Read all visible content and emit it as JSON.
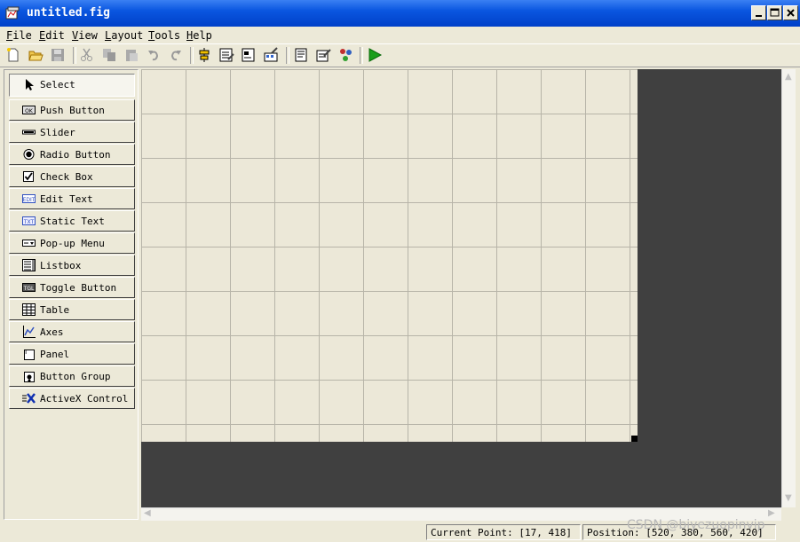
{
  "window": {
    "title": "untitled.fig"
  },
  "menu": [
    "File",
    "Edit",
    "View",
    "Layout",
    "Tools",
    "Help"
  ],
  "palette": [
    {
      "label": "Select",
      "icon": "cursor-arrow-icon",
      "selected": true
    },
    {
      "label": "Push Button",
      "icon": "push-button-icon"
    },
    {
      "label": "Slider",
      "icon": "slider-icon"
    },
    {
      "label": "Radio Button",
      "icon": "radio-button-icon"
    },
    {
      "label": "Check Box",
      "icon": "check-box-icon"
    },
    {
      "label": "Edit Text",
      "icon": "edit-text-icon"
    },
    {
      "label": "Static Text",
      "icon": "static-text-icon"
    },
    {
      "label": "Pop-up Menu",
      "icon": "popup-menu-icon"
    },
    {
      "label": "Listbox",
      "icon": "listbox-icon"
    },
    {
      "label": "Toggle Button",
      "icon": "toggle-button-icon"
    },
    {
      "label": "Table",
      "icon": "table-icon"
    },
    {
      "label": "Axes",
      "icon": "axes-icon"
    },
    {
      "label": "Panel",
      "icon": "panel-icon"
    },
    {
      "label": "Button Group",
      "icon": "button-group-icon"
    },
    {
      "label": "ActiveX Control",
      "icon": "activex-icon"
    }
  ],
  "icon_text": {
    "push_button": "OK",
    "edit_text": "EDIT",
    "static_text": "TXT",
    "toggle_button": "TGL"
  },
  "status": {
    "current_point_label": "Current Point:",
    "current_point_value": "[17, 418]",
    "position_label": "Position:",
    "position_value": "[520, 380, 560, 420]"
  },
  "watermark": "CSDN @biyezuopinvip",
  "colors": {
    "titlebar": "#0a56e0",
    "workspace": "#404040",
    "canvas": "#ece8d8",
    "run": "#1a9e1a"
  }
}
